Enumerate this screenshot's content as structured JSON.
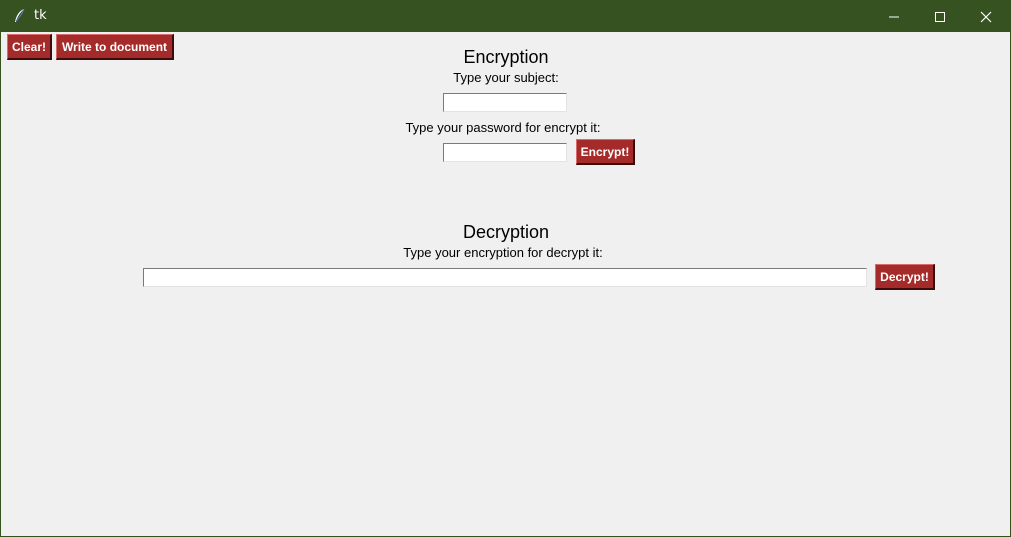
{
  "window": {
    "title": "tk",
    "controls": {
      "minimize": "minimize",
      "maximize": "maximize",
      "close": "close"
    }
  },
  "toolbar": {
    "clear_label": "Clear!",
    "write_label": "Write to document"
  },
  "encryption": {
    "heading": "Encryption",
    "subject_label": "Type your subject:",
    "subject_value": "",
    "password_label": "Type your password for encrypt it:",
    "password_value": "",
    "encrypt_label": "Encrypt!"
  },
  "decryption": {
    "heading": "Decryption",
    "input_label": "Type your encryption for decrypt it:",
    "input_value": "",
    "decrypt_label": "Decrypt!"
  },
  "colors": {
    "titlebar": "#365221",
    "button_bg": "#a52a2a",
    "button_text": "#ffffff",
    "window_bg": "#f0f0f0"
  },
  "icons": {
    "app": "feather-icon",
    "minimize": "minimize-icon",
    "maximize": "maximize-icon",
    "close": "close-icon"
  }
}
